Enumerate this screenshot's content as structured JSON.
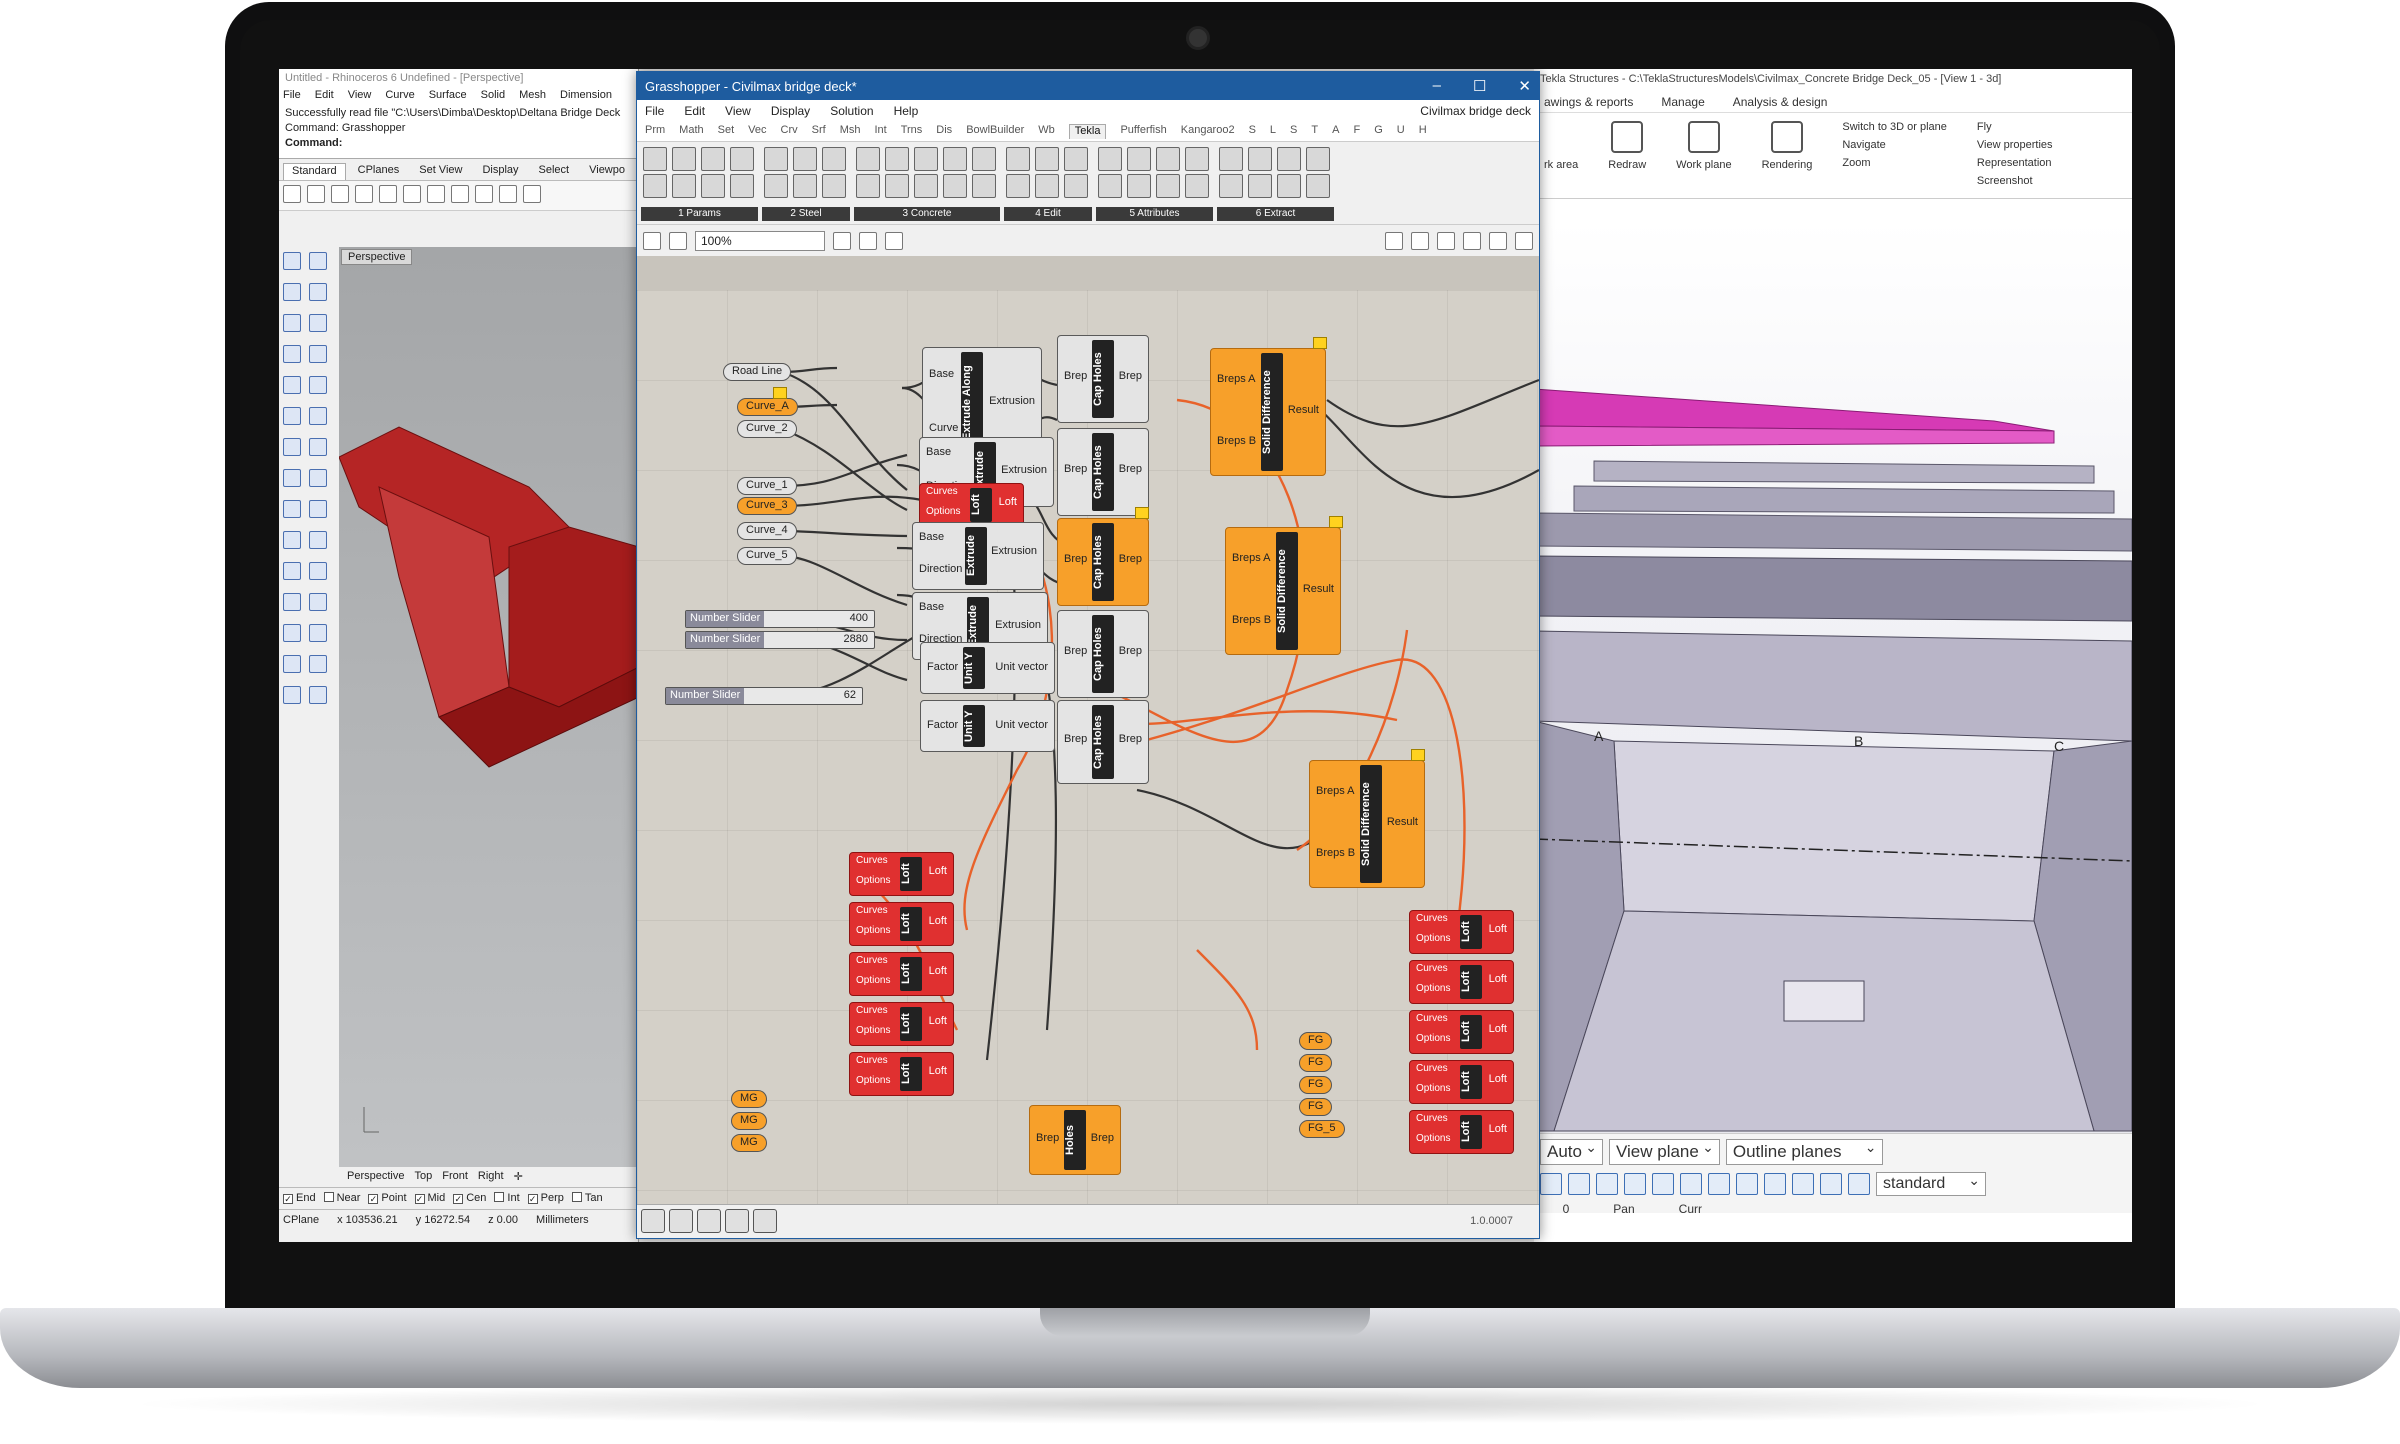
{
  "rhino": {
    "title": "Untitled - Rhinoceros 6 Undefined - [Perspective]",
    "menu": [
      "File",
      "Edit",
      "View",
      "Curve",
      "Surface",
      "Solid",
      "Mesh",
      "Dimension"
    ],
    "command_history": "Successfully read file \"C:\\Users\\Dimba\\Desktop\\Deltana Bridge Deck",
    "command_prev": "Command: Grasshopper",
    "command_prompt": "Command:",
    "tabs": [
      "Standard",
      "CPlanes",
      "Set View",
      "Display",
      "Select",
      "Viewpo"
    ],
    "viewport_label": "Perspective",
    "viewport_tabs": [
      "Perspective",
      "Top",
      "Front",
      "Right"
    ],
    "osnaps": [
      "End",
      "Near",
      "Point",
      "Mid",
      "Cen",
      "Int",
      "Perp",
      "Tan"
    ],
    "osnap_checked": [
      true,
      false,
      true,
      true,
      true,
      false,
      true,
      false
    ],
    "status": {
      "cplane": "CPlane",
      "x": "x 103536.21",
      "y": "y 16272.54",
      "z": "z 0.00",
      "units": "Millimeters"
    }
  },
  "grasshopper": {
    "title": "Grasshopper - Civilmax bridge deck*",
    "menu": [
      "File",
      "Edit",
      "View",
      "Display",
      "Solution",
      "Help"
    ],
    "doc_name": "Civilmax bridge deck",
    "tabs": [
      "Prm",
      "Math",
      "Set",
      "Vec",
      "Crv",
      "Srf",
      "Msh",
      "Int",
      "Trns",
      "Dis",
      "BowlBuilder",
      "Wb",
      "Tekla",
      "Pufferfish",
      "Kangaroo2",
      "S",
      "L",
      "S",
      "T",
      "A",
      "F",
      "G",
      "U",
      "H"
    ],
    "active_tab": "Tekla",
    "panels": [
      "1 Params",
      "2 Steel",
      "3 Concrete",
      "4 Edit",
      "5 Attributes",
      "6 Extract"
    ],
    "zoom": "100%",
    "version": "1.0.0007",
    "nodes": {
      "road_line": "Road Line",
      "curve_a": "Curve_A",
      "curve_2": "Curve_2",
      "curve_1": "Curve_1",
      "curve_3": "Curve_3",
      "curve_4": "Curve_4",
      "curve_5": "Curve_5",
      "extrude_along": "Extrude Along",
      "extrude": "Extrude",
      "loft": "Loft",
      "cap_holes": "Cap Holes",
      "solid_difference": "Solid Difference",
      "unit_y": "Unit Y",
      "holes": "Holes",
      "base": "Base",
      "curve": "Curve",
      "extrusion": "Extrusion",
      "direction": "Direction",
      "curves": "Curves",
      "options": "Options",
      "brep": "Brep",
      "breps_a": "Breps A",
      "breps_b": "Breps B",
      "result": "Result",
      "factor": "Factor",
      "unit_vector": "Unit vector",
      "mg": "MG",
      "fg": "FG",
      "fg_5": "FG_5",
      "number_slider": "Number Slider",
      "slider_values": [
        "400",
        "2880",
        "62"
      ]
    }
  },
  "tekla": {
    "title": "Tekla Structures - C:\\TeklaStructuresModels\\Civilmax_Concrete Bridge Deck_05 - [View 1 - 3d]",
    "ribbon_tabs": [
      "awings & reports",
      "Manage",
      "Analysis & design"
    ],
    "ribbon": {
      "work_area": "rk area",
      "redraw": "Redraw",
      "work_plane": "Work plane",
      "rendering": "Rendering",
      "switch": "Switch to 3D or plane",
      "navigate": "Navigate",
      "zoom": "Zoom",
      "fly": "Fly",
      "view_properties": "View properties",
      "representation": "Representation",
      "screenshot": "Screenshot"
    },
    "grid_labels": [
      "A",
      "B",
      "C"
    ],
    "selects": [
      "Auto",
      "View plane",
      "Outline planes"
    ],
    "standard": "standard",
    "status_values": [
      "0",
      "0",
      "Pan",
      "Curr"
    ]
  },
  "colors": {
    "gh_titlebar": "#1e5c9f",
    "orange_node": "#f7a02a",
    "red_node": "#e03030",
    "deck_magenta": "#d63ab5",
    "rhino_model": "#a41c1c"
  }
}
